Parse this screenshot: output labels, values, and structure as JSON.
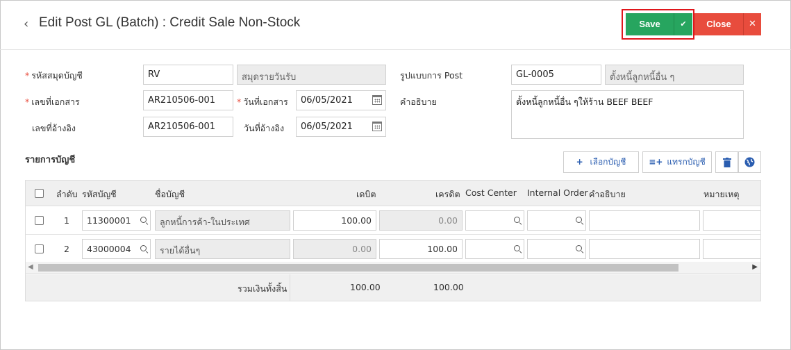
{
  "header": {
    "title": "Edit Post GL (Batch) : Credit Sale Non-Stock",
    "save_label": "Save",
    "close_label": "Close"
  },
  "form": {
    "journal_code_label": "รหัสสมุดบัญชี",
    "journal_code_value": "RV",
    "journal_name_value": "สมุดรายวันรับ",
    "post_format_label": "รูปแบบการ Post",
    "post_format_code": "GL-0005",
    "post_format_name": "ตั้งหนี้ลูกหนี้อื่น ๆ",
    "doc_no_label": "เลขที่เอกสาร",
    "doc_no_value": "AR210506-001",
    "doc_date_label": "วันที่เอกสาร",
    "doc_date_value": "06/05/2021",
    "description_label": "คำอธิบาย",
    "description_value": "ตั้งหนี้ลูกหนี้อื่น ๆให้ร้าน BEEF BEEF",
    "ref_no_label": "เลขที่อ้างอิง",
    "ref_no_value": "AR210506-001",
    "ref_date_label": "วันที่อ้างอิง",
    "ref_date_value": "06/05/2021"
  },
  "section": {
    "title": "รายการบัญชี",
    "select_account_label": "เลือกบัญชี",
    "insert_account_label": "แทรกบัญชี"
  },
  "table": {
    "columns": {
      "seq": "ลำดับ",
      "account_code": "รหัสบัญชี",
      "account_name": "ชื่อบัญชี",
      "debit": "เดบิต",
      "credit": "เครดิต",
      "cost_center": "Cost Center",
      "internal_order": "Internal Order",
      "description": "คำอธิบาย",
      "remark": "หมายเหตุ"
    },
    "rows": [
      {
        "seq": "1",
        "account_code": "11300001",
        "account_name": "ลูกหนี้การค้า-ในประเทศ",
        "debit": "100.00",
        "credit": "0.00"
      },
      {
        "seq": "2",
        "account_code": "43000004",
        "account_name": "รายได้อื่นๆ",
        "debit": "0.00",
        "credit": "100.00"
      }
    ],
    "footer": {
      "total_label": "รวมเงินทั้งสิ้น",
      "total_debit": "100.00",
      "total_credit": "100.00"
    }
  },
  "colors": {
    "save": "#27a55f",
    "close": "#e84c3d",
    "highlight": "#e0161c",
    "link": "#2a5db0"
  }
}
